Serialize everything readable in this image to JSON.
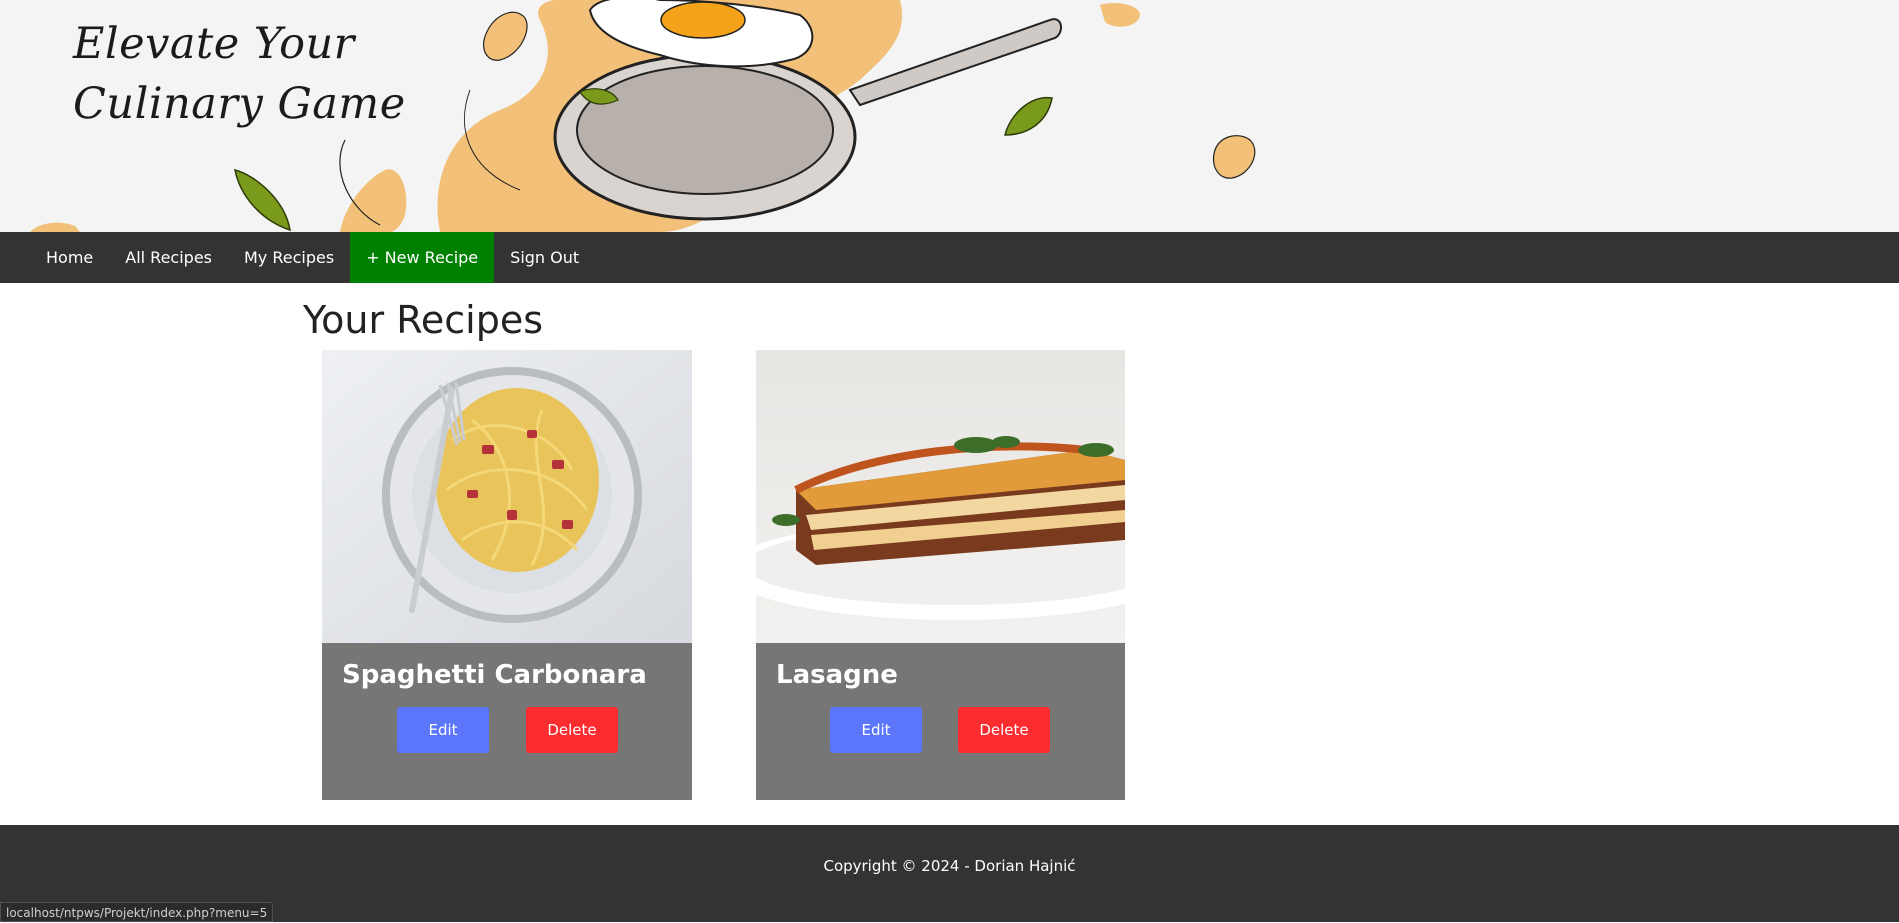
{
  "hero": {
    "title_line1": "Elevate Your",
    "title_line2": "Culinary Game"
  },
  "nav": {
    "items": [
      {
        "label": "Home"
      },
      {
        "label": "All Recipes"
      },
      {
        "label": "My Recipes"
      },
      {
        "label": "+ New Recipe",
        "active": true
      },
      {
        "label": "Sign Out"
      }
    ]
  },
  "main": {
    "title": "Your Recipes",
    "recipes": [
      {
        "name": "Spaghetti Carbonara",
        "edit_label": "Edit",
        "delete_label": "Delete"
      },
      {
        "name": "Lasagne",
        "edit_label": "Edit",
        "delete_label": "Delete"
      }
    ]
  },
  "footer": {
    "copyright": "Copyright © 2024 - Dorian Hajnić"
  },
  "status_bar": {
    "url": "localhost/ntpws/Projekt/index.php?menu=5"
  },
  "colors": {
    "nav_bg": "#333333",
    "nav_active": "#008000",
    "card_bg": "#767676",
    "edit_button": "#5b76fb",
    "delete_button": "#fb2c2f"
  }
}
